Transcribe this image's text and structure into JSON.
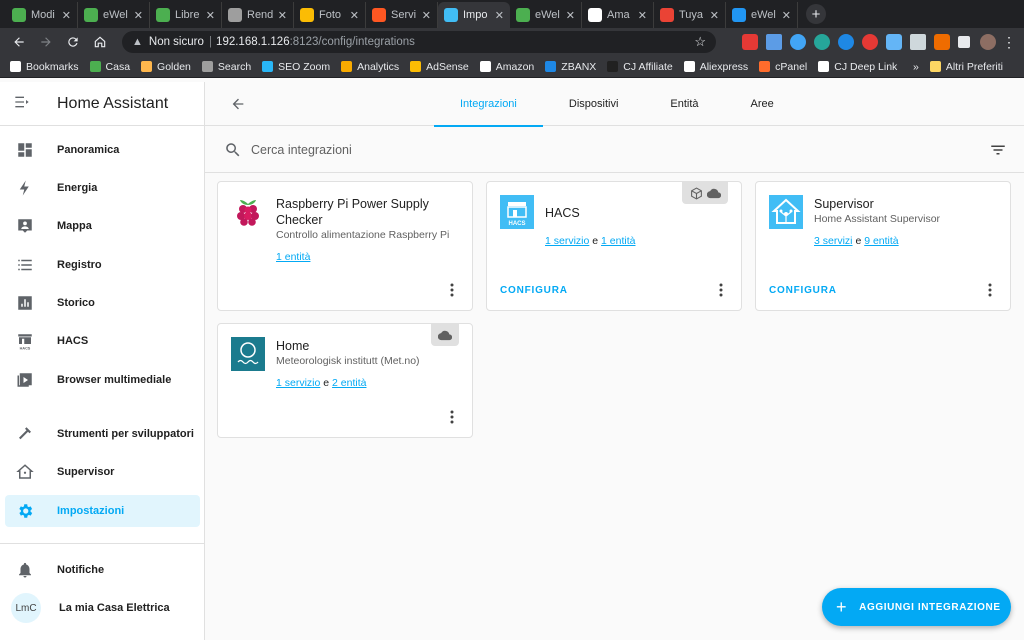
{
  "browser": {
    "tabs": [
      {
        "label": "Modi",
        "color": "#4caf50"
      },
      {
        "label": "eWel",
        "color": "#4caf50"
      },
      {
        "label": "Libre",
        "color": "#4caf50"
      },
      {
        "label": "Rend",
        "color": "#9e9e9e"
      },
      {
        "label": "Foto",
        "color": "#fbbc04"
      },
      {
        "label": "Servi",
        "color": "#ff5722"
      },
      {
        "label": "Impo",
        "color": "#41bdf5"
      },
      {
        "label": "eWel",
        "color": "#4caf50"
      },
      {
        "label": "Ama",
        "color": "#ffffff"
      },
      {
        "label": "Tuya",
        "color": "#ea4335"
      },
      {
        "label": "eWel",
        "color": "#2196f3"
      }
    ],
    "active_tab": 6,
    "close_glyph": "✕",
    "new_tab_label": "+",
    "address": {
      "security_label": "Non sicuro",
      "host": "192.168.1.126",
      "path": ":8123/config/integrations"
    },
    "bookmarks": [
      {
        "label": "Bookmarks",
        "color": "#ffffff"
      },
      {
        "label": "Casa",
        "color": "#4caf50"
      },
      {
        "label": "Golden",
        "color": "#ffb74d"
      },
      {
        "label": "Search",
        "color": "#9e9e9e"
      },
      {
        "label": "SEO Zoom",
        "color": "#29b6f6"
      },
      {
        "label": "Analytics",
        "color": "#f9ab00"
      },
      {
        "label": "AdSense",
        "color": "#fbbc04"
      },
      {
        "label": "Amazon",
        "color": "#ffffff"
      },
      {
        "label": "ZBANX",
        "color": "#1e88e5"
      },
      {
        "label": "CJ Affiliate",
        "color": "#212121"
      },
      {
        "label": "Aliexpress",
        "color": "#ffffff"
      },
      {
        "label": "cPanel",
        "color": "#ff6c2c"
      },
      {
        "label": "CJ Deep Link",
        "color": "#ffffff"
      }
    ],
    "more_bookmarks": "»",
    "other_bookmarks": "Altri Preferiti"
  },
  "app": {
    "title": "Home Assistant",
    "sidebar": {
      "items": [
        {
          "label": "Panoramica",
          "icon": "dashboard-icon"
        },
        {
          "label": "Energia",
          "icon": "lightning-bolt-icon"
        },
        {
          "label": "Mappa",
          "icon": "map-account-icon"
        },
        {
          "label": "Registro",
          "icon": "list-icon"
        },
        {
          "label": "Storico",
          "icon": "chart-box-icon"
        },
        {
          "label": "HACS",
          "icon": "hacs-icon"
        },
        {
          "label": "Browser multimediale",
          "icon": "play-box-icon"
        },
        {
          "label": "Strumenti per sviluppatori",
          "icon": "hammer-icon"
        },
        {
          "label": "Supervisor",
          "icon": "home-assistant-icon"
        },
        {
          "label": "Impostazioni",
          "icon": "cog-icon"
        }
      ],
      "active": "Impostazioni",
      "notifications_label": "Notifiche",
      "user": {
        "initials": "LmC",
        "name": "La mia Casa Elettrica"
      }
    },
    "tabs": [
      "Integrazioni",
      "Dispositivi",
      "Entità",
      "Aree"
    ],
    "active_tab": "Integrazioni",
    "search_placeholder": "Cerca integrazioni",
    "cards": [
      {
        "name": "Raspberry Pi Power Supply Checker",
        "subtitle": "Controllo alimentazione Raspberry Pi",
        "link1": "1 entità",
        "link2": "",
        "connector": "",
        "configure": ""
      },
      {
        "name": "HACS",
        "subtitle": "",
        "link1": "1 servizio",
        "connector": "e",
        "link2": "1 entità",
        "configure": "CONFIGURA",
        "logo_text": "HACS",
        "badges": [
          "cube-icon",
          "cloud-icon"
        ]
      },
      {
        "name": "Supervisor",
        "subtitle": "Home Assistant Supervisor",
        "link1": "3 servizi",
        "connector": "e",
        "link2": "9 entità",
        "configure": "CONFIGURA"
      },
      {
        "name": "Home",
        "subtitle": "Meteorologisk institutt (Met.no)",
        "link1": "1 servizio",
        "connector": "e",
        "link2": "2 entità",
        "configure": "",
        "badges": [
          "cloud-icon"
        ]
      }
    ],
    "fab_label": "AGGIUNGI INTEGRAZIONE"
  },
  "colors": {
    "primary": "#03a9f4",
    "sidebar_active_bg": "#e1f5fd",
    "browser_dark": "#202124"
  }
}
